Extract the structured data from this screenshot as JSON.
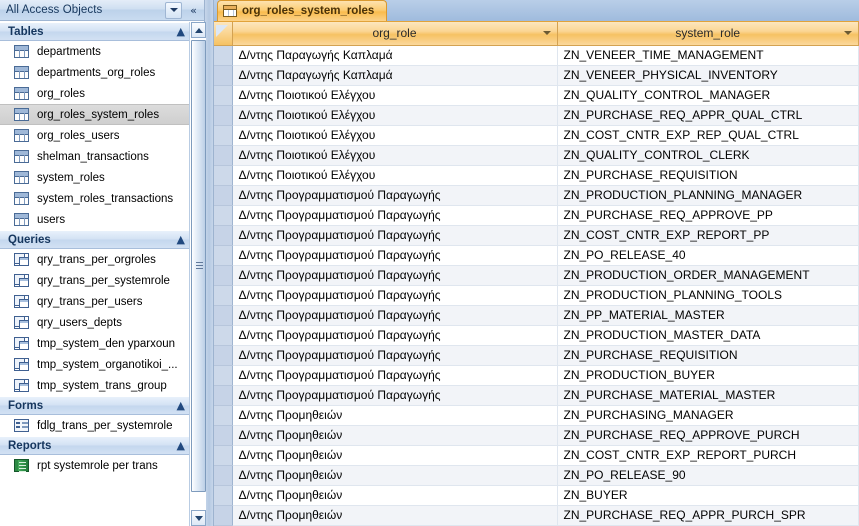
{
  "nav_pane": {
    "title": "All Access Objects",
    "dropdown_icon": "chevron-down-icon",
    "collapse_icon": "double-chevron-left-icon",
    "groups": [
      {
        "label": "Tables",
        "collapse_icon": "chevron-up-icon",
        "icon_type": "table-icon",
        "items": [
          {
            "label": "departments",
            "selected": false
          },
          {
            "label": "departments_org_roles",
            "selected": false
          },
          {
            "label": "org_roles",
            "selected": false
          },
          {
            "label": "org_roles_system_roles",
            "selected": true
          },
          {
            "label": "org_roles_users",
            "selected": false
          },
          {
            "label": "shelman_transactions",
            "selected": false
          },
          {
            "label": "system_roles",
            "selected": false
          },
          {
            "label": "system_roles_transactions",
            "selected": false
          },
          {
            "label": "users",
            "selected": false
          }
        ]
      },
      {
        "label": "Queries",
        "collapse_icon": "chevron-up-icon",
        "icon_type": "query-icon",
        "items": [
          {
            "label": "qry_trans_per_orgroles",
            "selected": false
          },
          {
            "label": "qry_trans_per_systemrole",
            "selected": false
          },
          {
            "label": "qry_trans_per_users",
            "selected": false
          },
          {
            "label": "qry_users_depts",
            "selected": false
          },
          {
            "label": "tmp_system_den yparxoun",
            "selected": false
          },
          {
            "label": "tmp_system_organotikoi_...",
            "selected": false
          },
          {
            "label": "tmp_system_trans_group",
            "selected": false
          }
        ]
      },
      {
        "label": "Forms",
        "collapse_icon": "chevron-up-icon",
        "icon_type": "form-icon",
        "items": [
          {
            "label": "fdlg_trans_per_systemrole",
            "selected": false
          }
        ]
      },
      {
        "label": "Reports",
        "collapse_icon": "chevron-up-icon",
        "icon_type": "report-icon",
        "items": [
          {
            "label": "rpt systemrole per trans",
            "selected": false
          }
        ]
      }
    ]
  },
  "document": {
    "tab": {
      "label": "org_roles_system_roles",
      "icon": "table-icon"
    },
    "datasheet": {
      "columns": [
        {
          "key": "org_role",
          "label": "org_role",
          "sort_icon": "chevron-down-icon"
        },
        {
          "key": "system_role",
          "label": "system_role",
          "sort_icon": "chevron-down-icon"
        }
      ],
      "rows": [
        {
          "org_role": "Δ/ντης Παραγωγής Καπλαμά",
          "system_role": "ZN_VENEER_TIME_MANAGEMENT"
        },
        {
          "org_role": "Δ/ντης Παραγωγής Καπλαμά",
          "system_role": "ZN_VENEER_PHYSICAL_INVENTORY"
        },
        {
          "org_role": "Δ/ντης Ποιοτικού Ελέγχου",
          "system_role": "ZN_QUALITY_CONTROL_MANAGER"
        },
        {
          "org_role": "Δ/ντης Ποιοτικού Ελέγχου",
          "system_role": "ZN_PURCHASE_REQ_APPR_QUAL_CTRL"
        },
        {
          "org_role": "Δ/ντης Ποιοτικού Ελέγχου",
          "system_role": "ZN_COST_CNTR_EXP_REP_QUAL_CTRL"
        },
        {
          "org_role": "Δ/ντης Ποιοτικού Ελέγχου",
          "system_role": "ZN_QUALITY_CONTROL_CLERK"
        },
        {
          "org_role": "Δ/ντης Ποιοτικού Ελέγχου",
          "system_role": "ZN_PURCHASE_REQUISITION"
        },
        {
          "org_role": "Δ/ντης Προγραμματισμού Παραγωγής",
          "system_role": "ZN_PRODUCTION_PLANNING_MANAGER"
        },
        {
          "org_role": "Δ/ντης Προγραμματισμού Παραγωγής",
          "system_role": "ZN_PURCHASE_REQ_APPROVE_PP"
        },
        {
          "org_role": "Δ/ντης Προγραμματισμού Παραγωγής",
          "system_role": "ZN_COST_CNTR_EXP_REPORT_PP"
        },
        {
          "org_role": "Δ/ντης Προγραμματισμού Παραγωγής",
          "system_role": "ZN_PO_RELEASE_40"
        },
        {
          "org_role": "Δ/ντης Προγραμματισμού Παραγωγής",
          "system_role": "ZN_PRODUCTION_ORDER_MANAGEMENT"
        },
        {
          "org_role": "Δ/ντης Προγραμματισμού Παραγωγής",
          "system_role": "ZN_PRODUCTION_PLANNING_TOOLS"
        },
        {
          "org_role": "Δ/ντης Προγραμματισμού Παραγωγής",
          "system_role": "ZN_PP_MATERIAL_MASTER"
        },
        {
          "org_role": "Δ/ντης Προγραμματισμού Παραγωγής",
          "system_role": "ZN_PRODUCTION_MASTER_DATA"
        },
        {
          "org_role": "Δ/ντης Προγραμματισμού Παραγωγής",
          "system_role": "ZN_PURCHASE_REQUISITION"
        },
        {
          "org_role": "Δ/ντης Προγραμματισμού Παραγωγής",
          "system_role": "ZN_PRODUCTION_BUYER"
        },
        {
          "org_role": "Δ/ντης Προγραμματισμού Παραγωγής",
          "system_role": "ZN_PURCHASE_MATERIAL_MASTER"
        },
        {
          "org_role": "Δ/ντης Προμηθειών",
          "system_role": "ZN_PURCHASING_MANAGER"
        },
        {
          "org_role": "Δ/ντης Προμηθειών",
          "system_role": "ZN_PURCHASE_REQ_APPROVE_PURCH"
        },
        {
          "org_role": "Δ/ντης Προμηθειών",
          "system_role": "ZN_COST_CNTR_EXP_REPORT_PURCH"
        },
        {
          "org_role": "Δ/ντης Προμηθειών",
          "system_role": "ZN_PO_RELEASE_90"
        },
        {
          "org_role": "Δ/ντης Προμηθειών",
          "system_role": "ZN_BUYER"
        },
        {
          "org_role": "Δ/ντης Προμηθειών",
          "system_role": "ZN_PURCHASE_REQ_APPR_PURCH_SPR"
        }
      ]
    }
  },
  "colors": {
    "tab_accent": "#f6c263",
    "nav_header": "#c4d7ee",
    "selection": "#cfcfcf",
    "grid_line": "#dfe6ef",
    "record_selector": "#cdd9ea"
  }
}
